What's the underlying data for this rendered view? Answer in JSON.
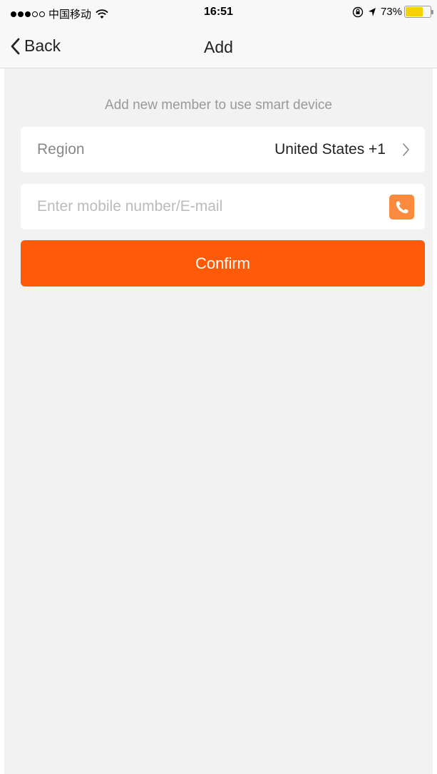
{
  "status_bar": {
    "carrier": "中国移动",
    "time": "16:51",
    "battery_percent": "73%",
    "battery_level": 0.73,
    "signal_bars_filled": 3,
    "signal_bars_total": 5
  },
  "nav": {
    "back_label": "Back",
    "title": "Add"
  },
  "main": {
    "subtitle": "Add new member to use smart device",
    "region_label": "Region",
    "region_value": "United States +1",
    "mobile_placeholder": "Enter mobile number/E-mail",
    "mobile_value": "",
    "confirm_label": "Confirm"
  },
  "icons": {
    "back": "chevron-left-icon",
    "region": "chevron-right-icon",
    "contacts": "phone-icon",
    "wifi": "wifi-icon",
    "orientation_lock": "orientation-lock-icon",
    "location": "location-arrow-icon"
  },
  "colors": {
    "accent": "#ff5a08",
    "contact_icon_bg": "#fb8a3f",
    "battery": "#f7d000",
    "background": "#f2f2f2"
  }
}
